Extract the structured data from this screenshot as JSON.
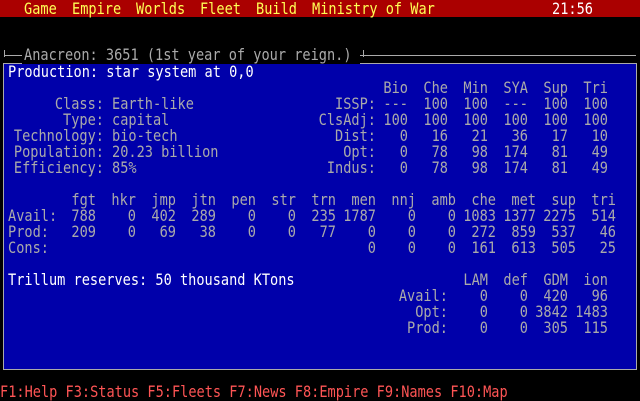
{
  "menu": {
    "items": [
      "Game",
      "Empire",
      "Worlds",
      "Fleet",
      "Build",
      "Ministry of War"
    ],
    "clock": "21:56"
  },
  "window": {
    "title": "Anacreon: 3651 (1st year of your reign.)",
    "heading": "Production: star system at 0,0"
  },
  "system": {
    "labels": [
      "Class:",
      "Type:",
      "Technology:",
      "Population:",
      "Efficiency:"
    ],
    "values": [
      "Earth-like",
      "capital",
      "bio-tech",
      "20.23 billion",
      "85%"
    ]
  },
  "resources": {
    "columns": [
      "Bio",
      "Che",
      "Min",
      "SYA",
      "Sup",
      "Tri"
    ],
    "rows": [
      {
        "label": "ISSP:",
        "values": [
          "---",
          "100",
          "100",
          "---",
          "100",
          "100"
        ]
      },
      {
        "label": "ClsAdj:",
        "values": [
          "100",
          "100",
          "100",
          "100",
          "100",
          "100"
        ]
      },
      {
        "label": "Dist:",
        "values": [
          "0",
          "16",
          "21",
          "36",
          "17",
          "10"
        ]
      },
      {
        "label": "Opt:",
        "values": [
          "0",
          "78",
          "98",
          "174",
          "81",
          "49"
        ]
      },
      {
        "label": "Indus:",
        "values": [
          "0",
          "78",
          "98",
          "174",
          "81",
          "49"
        ]
      }
    ]
  },
  "units": {
    "columns": [
      "fgt",
      "hkr",
      "jmp",
      "jtn",
      "pen",
      "str",
      "trn",
      "men",
      "nnj",
      "amb",
      "che",
      "met",
      "sup",
      "tri"
    ],
    "rows": [
      {
        "label": "Avail:",
        "values": [
          "788",
          "0",
          "402",
          "289",
          "0",
          "0",
          "235",
          "1787",
          "0",
          "0",
          "1083",
          "1377",
          "2275",
          "514"
        ]
      },
      {
        "label": "Prod:",
        "values": [
          "209",
          "0",
          "69",
          "38",
          "0",
          "0",
          "77",
          "0",
          "0",
          "0",
          "272",
          "859",
          "537",
          "46"
        ]
      },
      {
        "label": "Cons:",
        "values": [
          "",
          "",
          "",
          "",
          "",
          "",
          "",
          "0",
          "0",
          "0",
          "161",
          "613",
          "505",
          "25"
        ]
      }
    ]
  },
  "trillum": "Trillum reserves: 50 thousand KTons",
  "defense": {
    "columns": [
      "LAM",
      "def",
      "GDM",
      "ion"
    ],
    "rows": [
      {
        "label": "Avail:",
        "values": [
          "0",
          "0",
          "420",
          "96"
        ]
      },
      {
        "label": "Opt:",
        "values": [
          "0",
          "0",
          "3842",
          "1483"
        ]
      },
      {
        "label": "Prod:",
        "values": [
          "0",
          "0",
          "305",
          "115"
        ]
      }
    ]
  },
  "footer": "F1:Help F3:Status F5:Fleets F7:News F8:Empire F9:Names F10:Map"
}
